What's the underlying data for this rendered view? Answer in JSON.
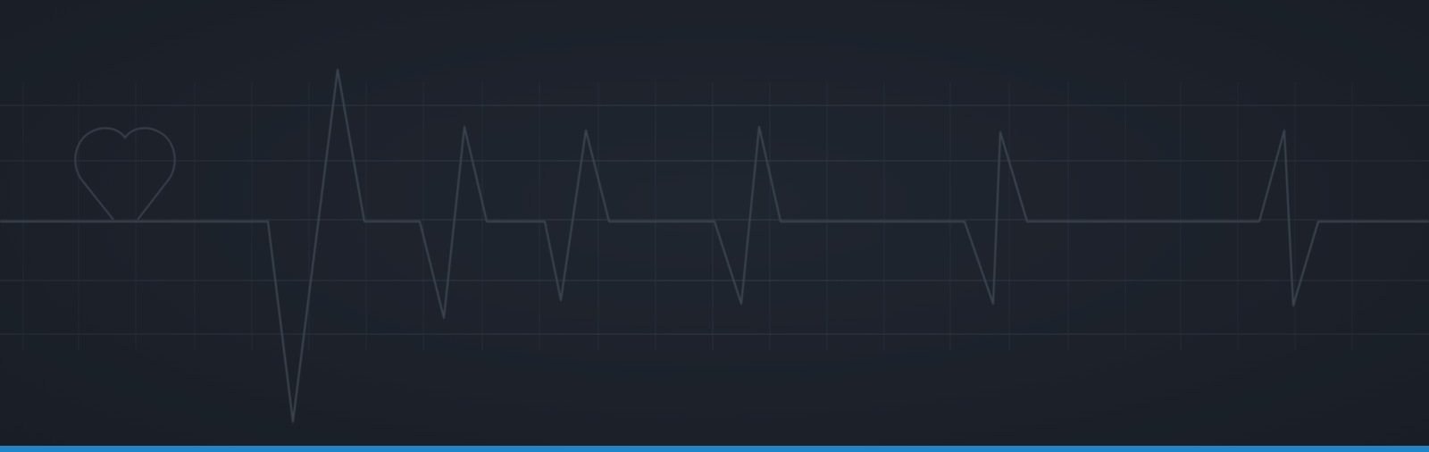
{
  "colors": {
    "background": "#1d222b",
    "grid_line": "#3a424e",
    "pulse_line": "#3b424c",
    "heart_outline": "#3a414b",
    "accent_bar": "#1e86c8"
  },
  "icons": {
    "heart": "heart-outline-icon",
    "pulse": "ecg-pulse-line"
  }
}
